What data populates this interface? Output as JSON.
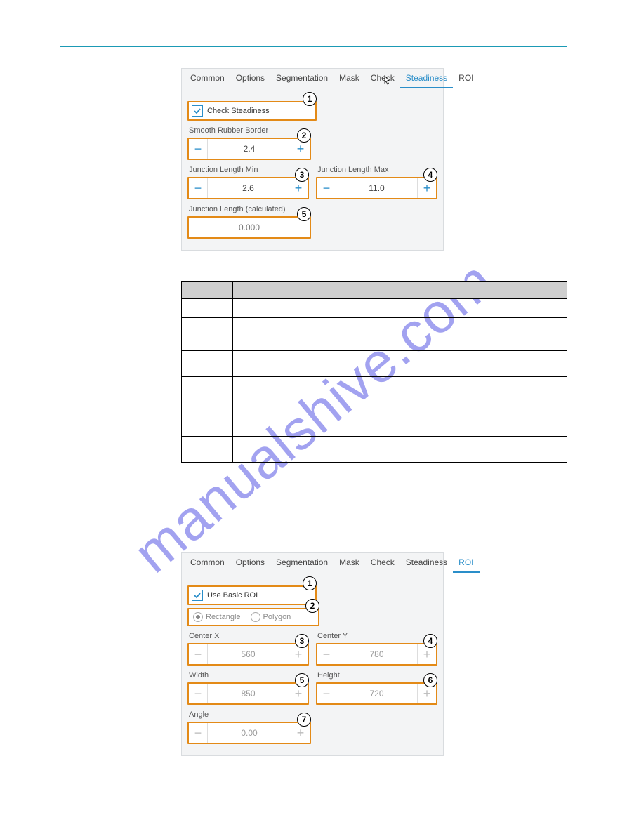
{
  "watermark": "manualshive.com",
  "panel1": {
    "tabs": [
      "Common",
      "Options",
      "Segmentation",
      "Mask",
      "Check",
      "Steadiness",
      "ROI"
    ],
    "active_tab": 5,
    "checkbox_label": "Check Steadiness",
    "labels": {
      "smooth": "Smooth Rubber Border",
      "jl_min": "Junction Length Min",
      "jl_max": "Junction Length Max",
      "jl_calc": "Junction Length (calculated)"
    },
    "values": {
      "smooth": "2.4",
      "jl_min": "2.6",
      "jl_max": "11.0",
      "jl_calc": "0.000"
    },
    "callouts": {
      "chk": "1",
      "smooth": "2",
      "jl_min": "3",
      "jl_max": "4",
      "jl_calc": "5"
    }
  },
  "panel2": {
    "tabs": [
      "Common",
      "Options",
      "Segmentation",
      "Mask",
      "Check",
      "Steadiness",
      "ROI"
    ],
    "active_tab": 6,
    "checkbox_label": "Use Basic ROI",
    "radio": {
      "rectangle": "Rectangle",
      "polygon": "Polygon"
    },
    "labels": {
      "cx": "Center X",
      "cy": "Center Y",
      "w": "Width",
      "h": "Height",
      "angle": "Angle"
    },
    "values": {
      "cx": "560",
      "cy": "780",
      "w": "850",
      "h": "720",
      "angle": "0.00"
    },
    "callouts": {
      "chk": "1",
      "radio": "2",
      "cx": "3",
      "cy": "4",
      "w": "5",
      "h": "6",
      "angle": "7"
    }
  },
  "glyphs": {
    "minus": "−",
    "plus": "+"
  }
}
